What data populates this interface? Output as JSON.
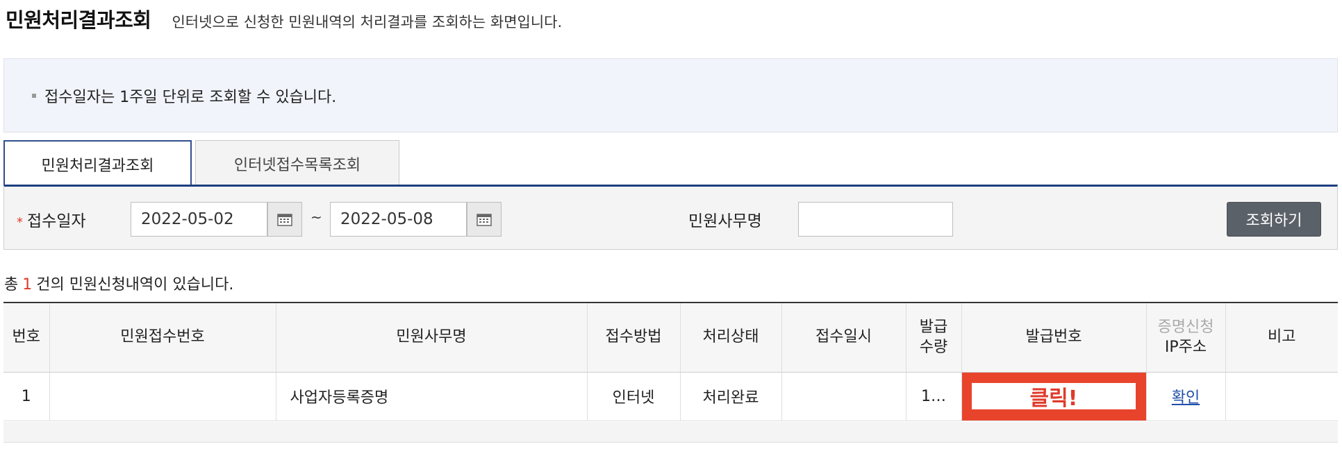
{
  "header": {
    "title": "민원처리결과조회",
    "description": "인터넷으로 신청한 민원내역의 처리결과를 조회하는 화면입니다."
  },
  "notice": {
    "text": "접수일자는 1주일 단위로 조회할 수 있습니다."
  },
  "tabs": [
    {
      "label": "민원처리결과조회",
      "active": true
    },
    {
      "label": "인터넷접수목록조회",
      "active": false
    }
  ],
  "search": {
    "required_mark": "*",
    "date_label": "접수일자",
    "start_date": "2022-05-02",
    "separator": "~",
    "end_date": "2022-05-08",
    "office_label": "민원사무명",
    "office_value": "",
    "button_label": "조회하기"
  },
  "summary": {
    "prefix": "총",
    "count": "1",
    "suffix": "건의 민원신청내역이 있습니다."
  },
  "table": {
    "headers": {
      "no": "번호",
      "receipt_no": "민원접수번호",
      "office_name": "민원사무명",
      "method": "접수방법",
      "status": "처리상태",
      "received_at": "접수일시",
      "qty_line1": "발급",
      "qty_line2": "수량",
      "issue_no": "발급번호",
      "ip_line1": "증명신청",
      "ip_line2": "IP주소",
      "note": "비고"
    },
    "rows": [
      {
        "no": "1",
        "receipt_no": "",
        "office_name": "사업자등록증명",
        "method": "인터넷",
        "status": "처리완료",
        "received_at": "",
        "qty": "1…",
        "issue_no": "클릭!",
        "ip": "확인",
        "note": ""
      }
    ]
  },
  "colors": {
    "accent_navy": "#1b3f7e",
    "highlight_red": "#e8442c",
    "link_blue": "#1f4fa8"
  }
}
